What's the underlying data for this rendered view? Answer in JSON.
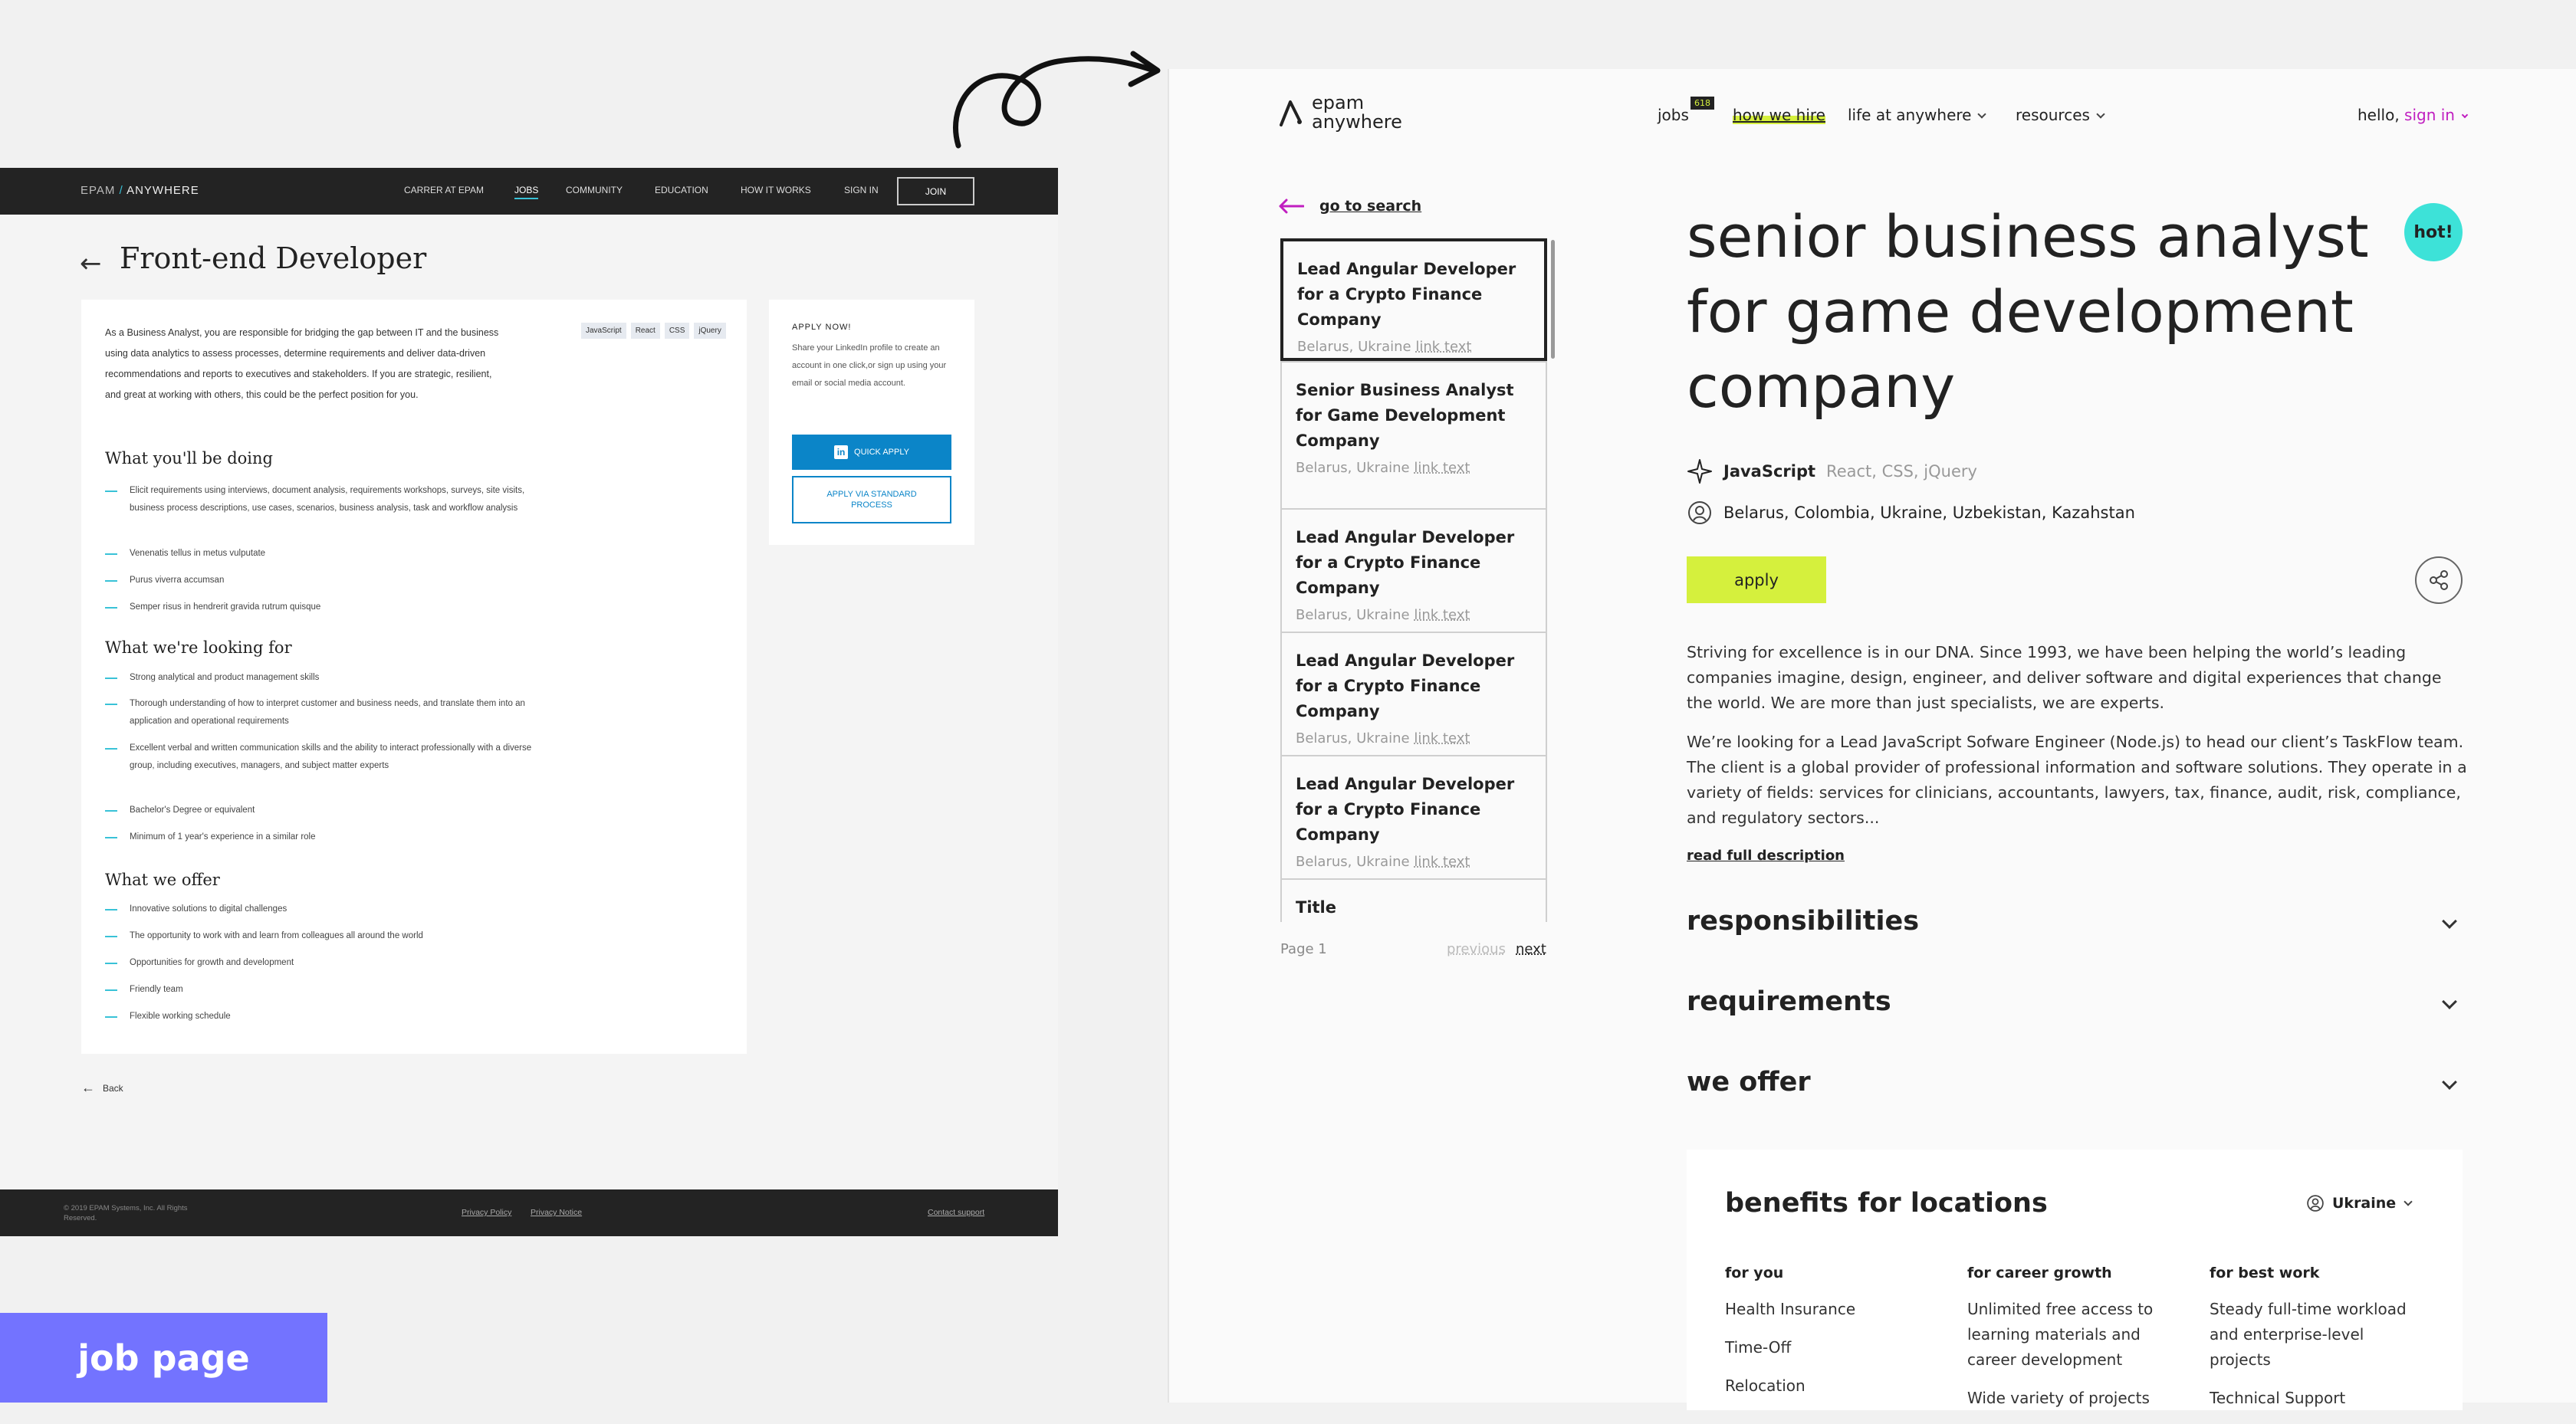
{
  "old_page": {
    "logo_left": "EPAM",
    "logo_sep": "/",
    "logo_right": "ANYWHERE",
    "nav": [
      "CARRER AT EPAM",
      "JOBS",
      "COMMUNITY",
      "EDUCATION",
      "HOW IT WORKS",
      "SIGN IN"
    ],
    "join": "JOIN",
    "title": "Front-end Developer",
    "intro": "As a Business Analyst, you are responsible for bridging the gap between IT and the business using data analytics to assess processes, determine requirements and deliver data-driven recommendations and reports to executives and stakeholders. If you are strategic, resilient, and great at working with others, this could be the perfect position for you.",
    "tags": [
      "JavaScript",
      "React",
      "CSS",
      "jQuery"
    ],
    "sections": [
      {
        "title": "What you'll be doing",
        "items": [
          "Elicit requirements using interviews, document analysis, requirements workshops, surveys, site visits, business process descriptions, use cases, scenarios, business analysis, task and workflow analysis",
          "Venenatis tellus in metus vulputate",
          "Purus viverra accumsan",
          "Semper risus in hendrerit gravida rutrum quisque"
        ]
      },
      {
        "title": "What we're looking for",
        "items": [
          "Strong analytical and product management skills",
          "Thorough understanding of how to interpret customer and business needs, and translate them into an application and operational requirements",
          "Excellent verbal and written communication skills and the ability to interact professionally with a diverse group, including executives, managers, and subject matter experts",
          "Bachelor's Degree or equivalent",
          "Minimum of 1 year's experience in a similar role"
        ]
      },
      {
        "title": "What we offer",
        "items": [
          "Innovative solutions to digital challenges",
          "The opportunity to work with and learn from colleagues all around the world",
          "Opportunities for growth and development",
          "Friendly team",
          "Flexible working schedule"
        ]
      }
    ],
    "apply_heading": "APPLY NOW!",
    "apply_text": "Share your LinkedIn profile to create an account in one click,or sign up using your email or social media account.",
    "quick_apply": "QUICK APPLY",
    "standard_apply": "APPLY VIA STANDARD PROCESS",
    "back": "Back",
    "footer_copy": "© 2019 EPAM Systems, Inc. All Rights Reserved.",
    "footer_links": [
      "Privacy Policy",
      "Privacy Notice",
      "Contact support"
    ]
  },
  "label": "job page",
  "new_page": {
    "logo_line1": "epam",
    "logo_line2": "anywhere",
    "nav": {
      "jobs": "jobs",
      "jobs_count": "618",
      "how_we_hire": "how we hire",
      "life": "life at anywhere",
      "resources": "resources"
    },
    "hello": "hello,",
    "sign_in": "sign in",
    "go_to_search": "go to search",
    "job_list": [
      {
        "title": "Lead Angular Developer for a Crypto Finance Company",
        "location": "Belarus, Ukraine",
        "link": "link text"
      },
      {
        "title": "Senior Business Analyst for Game Development Company",
        "location": "Belarus, Ukraine",
        "link": "link text"
      },
      {
        "title": "Lead Angular Developer for a Crypto Finance Company",
        "location": "Belarus, Ukraine",
        "link": "link text"
      },
      {
        "title": "Lead Angular Developer for a Crypto Finance Company",
        "location": "Belarus, Ukraine",
        "link": "link text"
      },
      {
        "title": "Lead Angular Developer for a Crypto Finance Company",
        "location": "Belarus, Ukraine",
        "link": "link text"
      },
      {
        "title": "Title",
        "location": "",
        "link": ""
      }
    ],
    "page_label": "Page 1",
    "previous": "previous",
    "next": "next",
    "title": "senior business analyst for game development company",
    "hot": "hot!",
    "skill_main": "JavaScript",
    "skill_rest": "React, CSS, jQuery",
    "locations": "Belarus, Colombia, Ukraine, Uzbekistan, Kazahstan",
    "apply": "apply",
    "desc_1": "Striving for excellence is in our DNA. Since 1993, we have been helping the world’s leading companies imagine, design, engineer, and deliver software and digital experiences that change the world. We are more than just specialists, we are experts.",
    "desc_2": "We’re looking for a Lead JavaScript Sofware Engineer (Node.js) to head our client’s TaskFlow team. The client is a global provider of professional information and software solutions. They operate in a variety of fields: services for clinicians, accountants, lawyers, tax, finance, audit, risk, compliance, and regulatory sectors...",
    "read_full": "read full description",
    "accordions": [
      "responsibilities",
      "requirements",
      "we offer"
    ],
    "benefits_title": "benefits for locations",
    "benefits_country": "Ukraine",
    "benefit_cols": [
      {
        "heading": "for you",
        "items": [
          "Health Insurance",
          "Time-Off",
          "Relocation"
        ]
      },
      {
        "heading": "for career growth",
        "items": [
          "Unlimited free access to learning materials and career development",
          "Wide variety of projects"
        ]
      },
      {
        "heading": "for best work",
        "items": [
          "Steady full-time workload and enterprise-level projects",
          "Technical Support"
        ]
      }
    ]
  },
  "colors": {
    "accent_lime": "#d5f03d",
    "accent_cyan": "#3de2d8",
    "accent_magenta": "#c01ec0",
    "label_purple": "#7373ff",
    "old_blue": "#0b85c8",
    "old_teal": "#39c2d7"
  }
}
